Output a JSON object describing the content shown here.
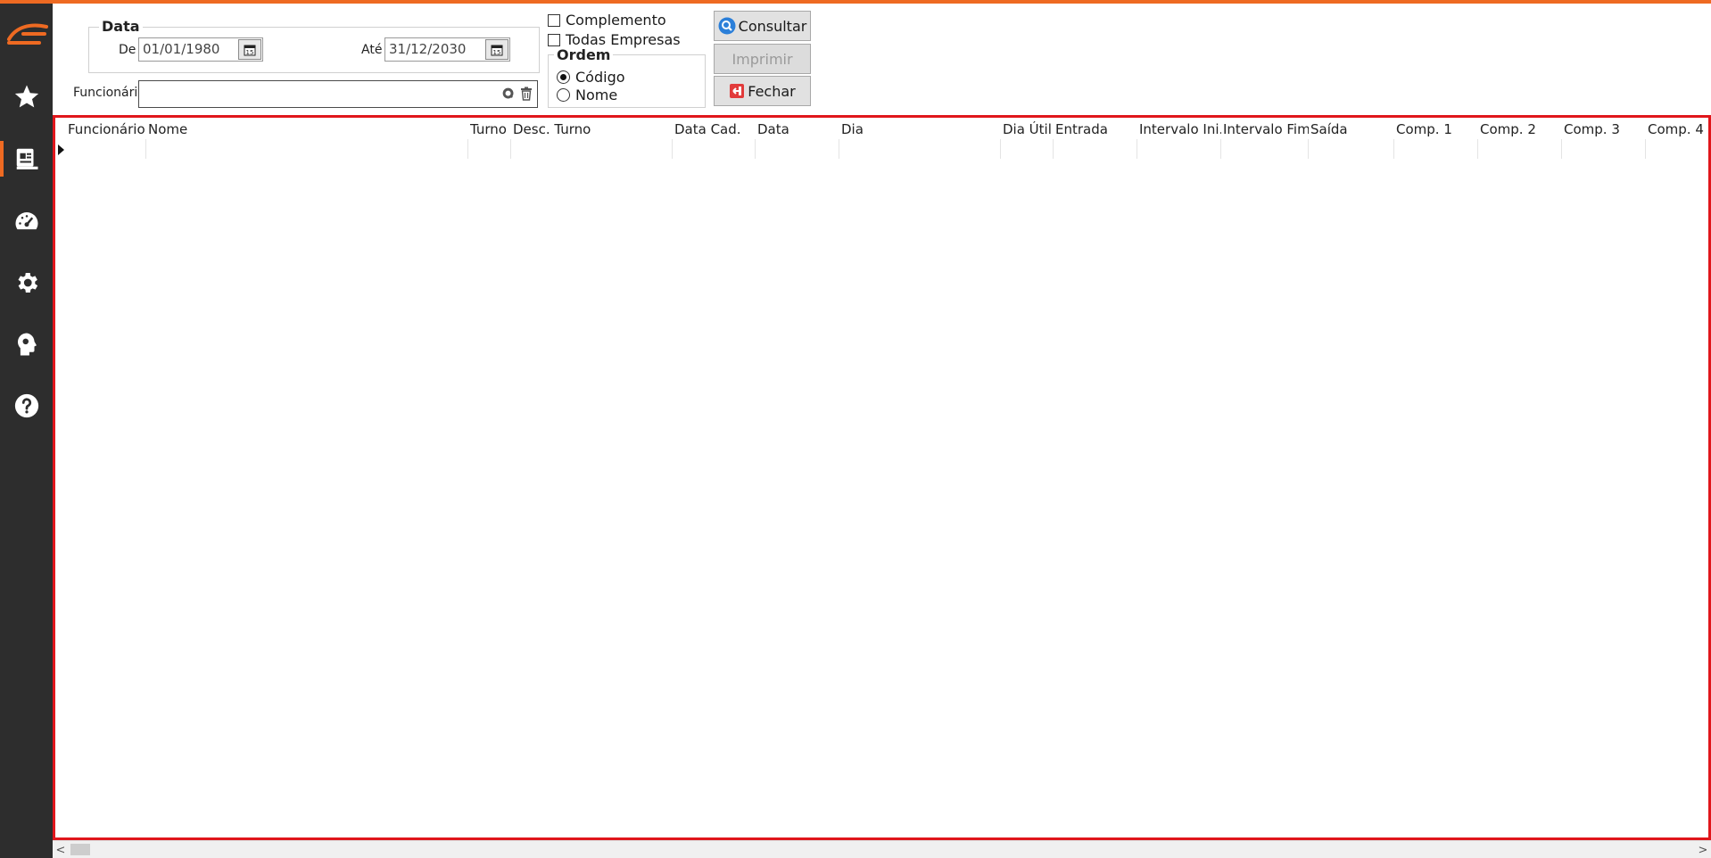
{
  "sidebar": {
    "items": [
      {
        "name": "favorites-star-icon"
      },
      {
        "name": "reports-icon"
      },
      {
        "name": "dashboard-gauge-icon"
      },
      {
        "name": "settings-gear-icon"
      },
      {
        "name": "support-head-icon"
      },
      {
        "name": "help-question-icon"
      }
    ]
  },
  "filters": {
    "date_group_label": "Data",
    "from_label": "De",
    "from_value": "01/01/1980",
    "to_label": "Até",
    "to_value": "31/12/2030",
    "employee_label": "Funcionário",
    "employee_value": "",
    "complemento_label": "Complemento",
    "todas_empresas_label": "Todas Empresas",
    "order_group_label": "Ordem",
    "order_options": [
      "Código",
      "Nome"
    ],
    "order_selected": "Código"
  },
  "actions": {
    "consultar": "Consultar",
    "imprimir": "Imprimir",
    "fechar": "Fechar"
  },
  "grid": {
    "columns": [
      "Funcionário",
      "Nome",
      "Turno",
      "Desc. Turno",
      "Data Cad.",
      "Data",
      "Dia",
      "Dia Útil",
      "Entrada",
      "Intervalo Ini.",
      "Intervalo Fim",
      "Saída",
      "Comp. 1",
      "Comp. 2",
      "Comp. 3",
      "Comp. 4"
    ]
  },
  "colors": {
    "accent": "#ee6a22",
    "grid_border": "#e0161b",
    "sidebar_bg": "#2d2d2d"
  }
}
